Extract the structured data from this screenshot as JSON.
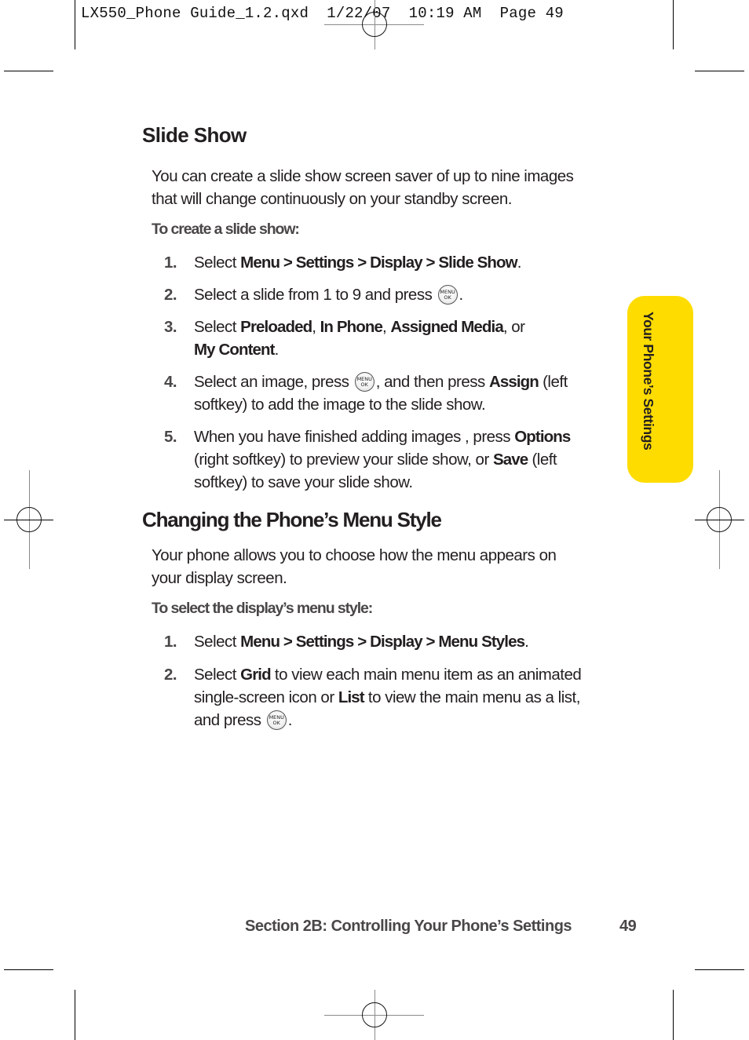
{
  "slug_line": "LX550_Phone Guide_1.2.qxd  1/22/07  10:19 AM  Page 49",
  "side_tab": {
    "label": "Your Phone’s Settings",
    "color": "#ffdc00"
  },
  "key_icon": {
    "name": "menu-ok-key",
    "line1": "MENU",
    "line2": "OK"
  },
  "slide_show": {
    "heading": "Slide Show",
    "intro_line1": "You can create a slide show screen saver of up to nine images",
    "intro_line2": "that will change continuously on your standby screen.",
    "subheading": "To create a slide show:",
    "steps": [
      {
        "num": "1.",
        "pre": "Select ",
        "bold": "Menu > Settings > Display > Slide Show",
        "post": "."
      },
      {
        "num": "2.",
        "pre": "Select a slide from 1 to 9 and press",
        "post": "."
      },
      {
        "num": "3.",
        "pre": "Select ",
        "b1": "Preloaded",
        "s1": ", ",
        "b2": "In Phone",
        "s2": ", ",
        "b3": "Assigned Media",
        "s3": ", or",
        "b4": "My Content",
        "post": "."
      },
      {
        "num": "4.",
        "pre": "Select an image, press",
        "mid": ", and then press ",
        "bold": "Assign",
        "post1": " (left",
        "line2": "softkey) to add the image to the slide show."
      },
      {
        "num": "5.",
        "pre": "When you have finished adding images , press ",
        "bold": "Options",
        "line2_pre": "(right softkey) to preview your slide show, or ",
        "bold2": "Save",
        "line2_post": " (left",
        "line3": "softkey) to save your slide show."
      }
    ]
  },
  "menu_style": {
    "heading": "Changing the Phone’s Menu Style",
    "intro_line1": "Your phone allows you to choose how the menu appears on",
    "intro_line2": "your display screen.",
    "subheading": "To select the display’s menu style:",
    "steps": [
      {
        "num": "1.",
        "pre": "Select ",
        "bold": "Menu > Settings > Display > Menu Styles",
        "post": "."
      },
      {
        "num": "2.",
        "pre": "Select ",
        "bold": "Grid",
        "mid": " to view each main menu item as an animated",
        "line2_pre": "single-screen icon or ",
        "bold2": "List",
        "line2_post": " to view the main menu as a list,",
        "line3_pre": "and press",
        "post": "."
      }
    ]
  },
  "footer": {
    "section": "Section 2B: Controlling Your Phone’s Settings",
    "page": "49"
  }
}
